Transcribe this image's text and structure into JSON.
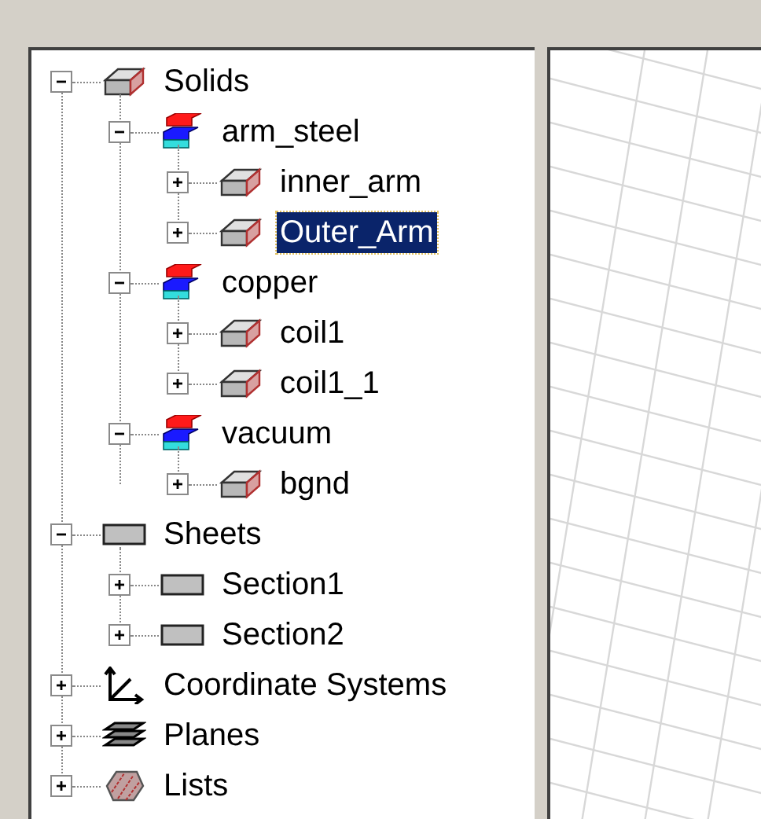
{
  "tree": [
    {
      "label": "Solids",
      "kind": "solid",
      "expanded": true,
      "selected": false,
      "children": [
        {
          "label": "arm_steel",
          "kind": "material",
          "expanded": true,
          "selected": false,
          "children": [
            {
              "label": "inner_arm",
              "kind": "solid",
              "expanded": false,
              "selected": false
            },
            {
              "label": "Outer_Arm",
              "kind": "solid",
              "expanded": false,
              "selected": true
            }
          ]
        },
        {
          "label": "copper",
          "kind": "material",
          "expanded": true,
          "selected": false,
          "children": [
            {
              "label": "coil1",
              "kind": "solid",
              "expanded": false,
              "selected": false
            },
            {
              "label": "coil1_1",
              "kind": "solid",
              "expanded": false,
              "selected": false
            }
          ]
        },
        {
          "label": "vacuum",
          "kind": "material",
          "expanded": true,
          "selected": false,
          "children": [
            {
              "label": "bgnd",
              "kind": "solid",
              "expanded": false,
              "selected": false
            }
          ]
        }
      ]
    },
    {
      "label": "Sheets",
      "kind": "sheet",
      "expanded": true,
      "selected": false,
      "children": [
        {
          "label": "Section1",
          "kind": "sheet",
          "expanded": false,
          "selected": false
        },
        {
          "label": "Section2",
          "kind": "sheet",
          "expanded": false,
          "selected": false
        }
      ]
    },
    {
      "label": "Coordinate Systems",
      "kind": "coords",
      "expanded": false,
      "selected": false
    },
    {
      "label": "Planes",
      "kind": "planes",
      "expanded": false,
      "selected": false
    },
    {
      "label": "Lists",
      "kind": "lists",
      "expanded": false,
      "selected": false
    }
  ]
}
